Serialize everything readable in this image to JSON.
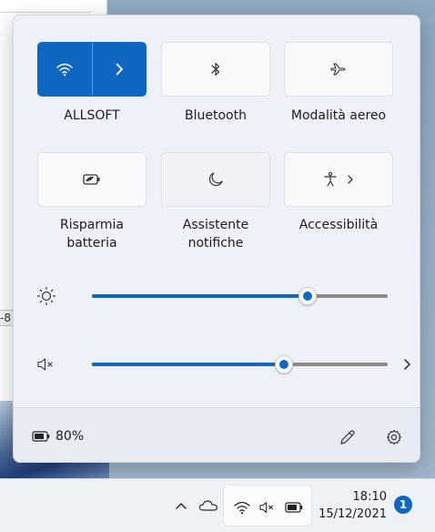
{
  "background": {
    "window_snippet": "-8"
  },
  "quick_settings": {
    "tiles": [
      {
        "id": "wifi",
        "label": "ALLSOFT",
        "icon": "wifi-icon",
        "active": true
      },
      {
        "id": "bluetooth",
        "label": "Bluetooth",
        "icon": "bluetooth-icon",
        "active": false
      },
      {
        "id": "airplane",
        "label": "Modalità aereo",
        "icon": "airplane-icon",
        "active": false
      },
      {
        "id": "battery_saver",
        "label_line1": "Risparmia",
        "label_line2": "batteria",
        "icon": "battery-saver-icon",
        "active": false
      },
      {
        "id": "focus_assist",
        "label_line1": "Assistente",
        "label_line2": "notifiche",
        "icon": "moon-icon",
        "active": false
      },
      {
        "id": "accessibility",
        "label": "Accessibilità",
        "icon": "accessibility-icon",
        "active": false
      }
    ],
    "brightness": {
      "icon": "brightness-icon",
      "level": 0.73
    },
    "volume": {
      "icon": "speaker-muted-icon",
      "level": 0.65,
      "muted": true
    },
    "footer": {
      "battery_percent": "80%",
      "battery_icon": "battery-icon",
      "edit_icon": "pencil-icon",
      "settings_icon": "gear-icon"
    }
  },
  "taskbar": {
    "chevron_icon": "chevron-up-icon",
    "onedrive_icon": "cloud-icon",
    "time": "18:10",
    "date": "15/12/2021",
    "notification_count": "1"
  },
  "colors": {
    "accent": "#0f67c1",
    "panel": "#eef2f8",
    "slider_track": "#8a8a8a"
  }
}
